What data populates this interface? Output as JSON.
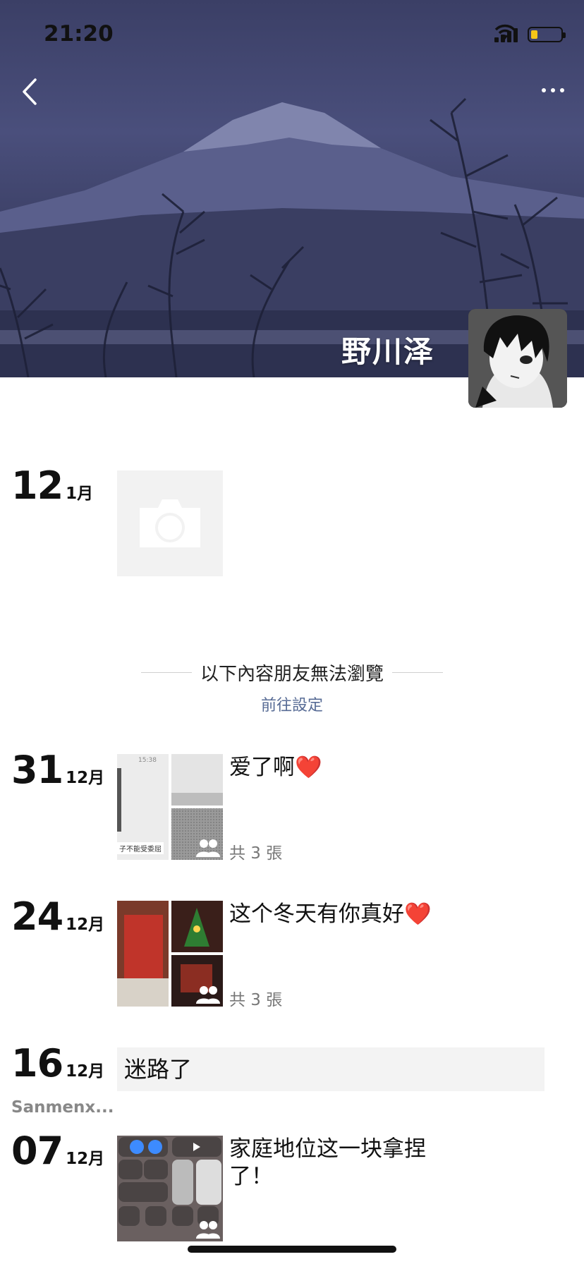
{
  "status": {
    "time": "21:20",
    "battery_color": "#f5c518"
  },
  "header": {
    "profile_name": "野川泽",
    "back_icon": "chevron-left-icon",
    "more_icon": "ellipsis-icon"
  },
  "posts_visible": [
    {
      "day": "12",
      "month": "1月",
      "type": "camera-placeholder"
    }
  ],
  "privacy": {
    "divider_text": "以下內容朋友無法瀏覽",
    "settings_link": "前往設定",
    "link_color": "#576b95"
  },
  "posts": [
    {
      "day": "31",
      "month": "12月",
      "text": "爱了啊❤️",
      "count": "共 3 張"
    },
    {
      "day": "24",
      "month": "12月",
      "text": "这个冬天有你真好❤️",
      "count": "共 3 張"
    },
    {
      "day": "16",
      "month": "12月",
      "text": "迷路了",
      "location": "Sanmenx..."
    },
    {
      "day": "07",
      "month": "12月",
      "text": "家庭地位这一块拿捏了！"
    }
  ],
  "thumb_text": {
    "phone_caption": "子不能受委屈",
    "phone_time": "15:38"
  }
}
